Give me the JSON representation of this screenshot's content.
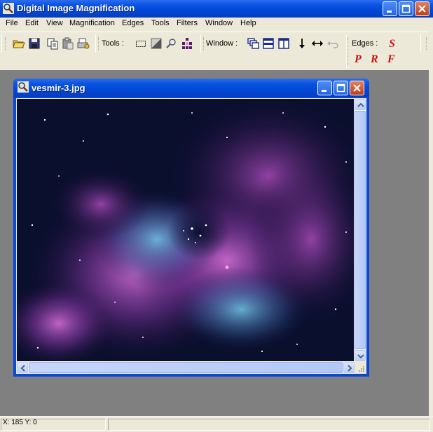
{
  "app": {
    "title": "Digital Image Magnification",
    "icon": "magnifier-icon"
  },
  "menu": {
    "items": [
      "File",
      "Edit",
      "View",
      "Magnification",
      "Edges",
      "Tools",
      "Filters",
      "Window",
      "Help"
    ]
  },
  "toolbar": {
    "file_icons": [
      "open-folder-icon",
      "save-icon",
      "copy-icon",
      "paste-icon",
      "print-icon"
    ],
    "tools_label": "Tools :",
    "tools_icons": [
      "rect-select-icon",
      "gradient-icon",
      "zoom-icon",
      "grid-icon"
    ],
    "window_label": "Window :",
    "window_icons": [
      "cascade-icon",
      "tile-horizontal-icon",
      "tile-vertical-icon",
      "arrow-down-icon",
      "arrow-both-icon",
      "arrow-back-disabled-icon"
    ],
    "edges_label": "Edges :",
    "edges_letters": [
      "S",
      "P",
      "R",
      "F"
    ]
  },
  "document": {
    "title": "vesmir-3.jpg",
    "icon": "image-file-icon",
    "image_desc": "nebula"
  },
  "status": {
    "coords": "X: 185  Y: 0"
  },
  "colors": {
    "titlebar": "#0a52e0",
    "chrome": "#ece9d8",
    "workspace": "#808080",
    "edge_letters": "#d01010"
  }
}
